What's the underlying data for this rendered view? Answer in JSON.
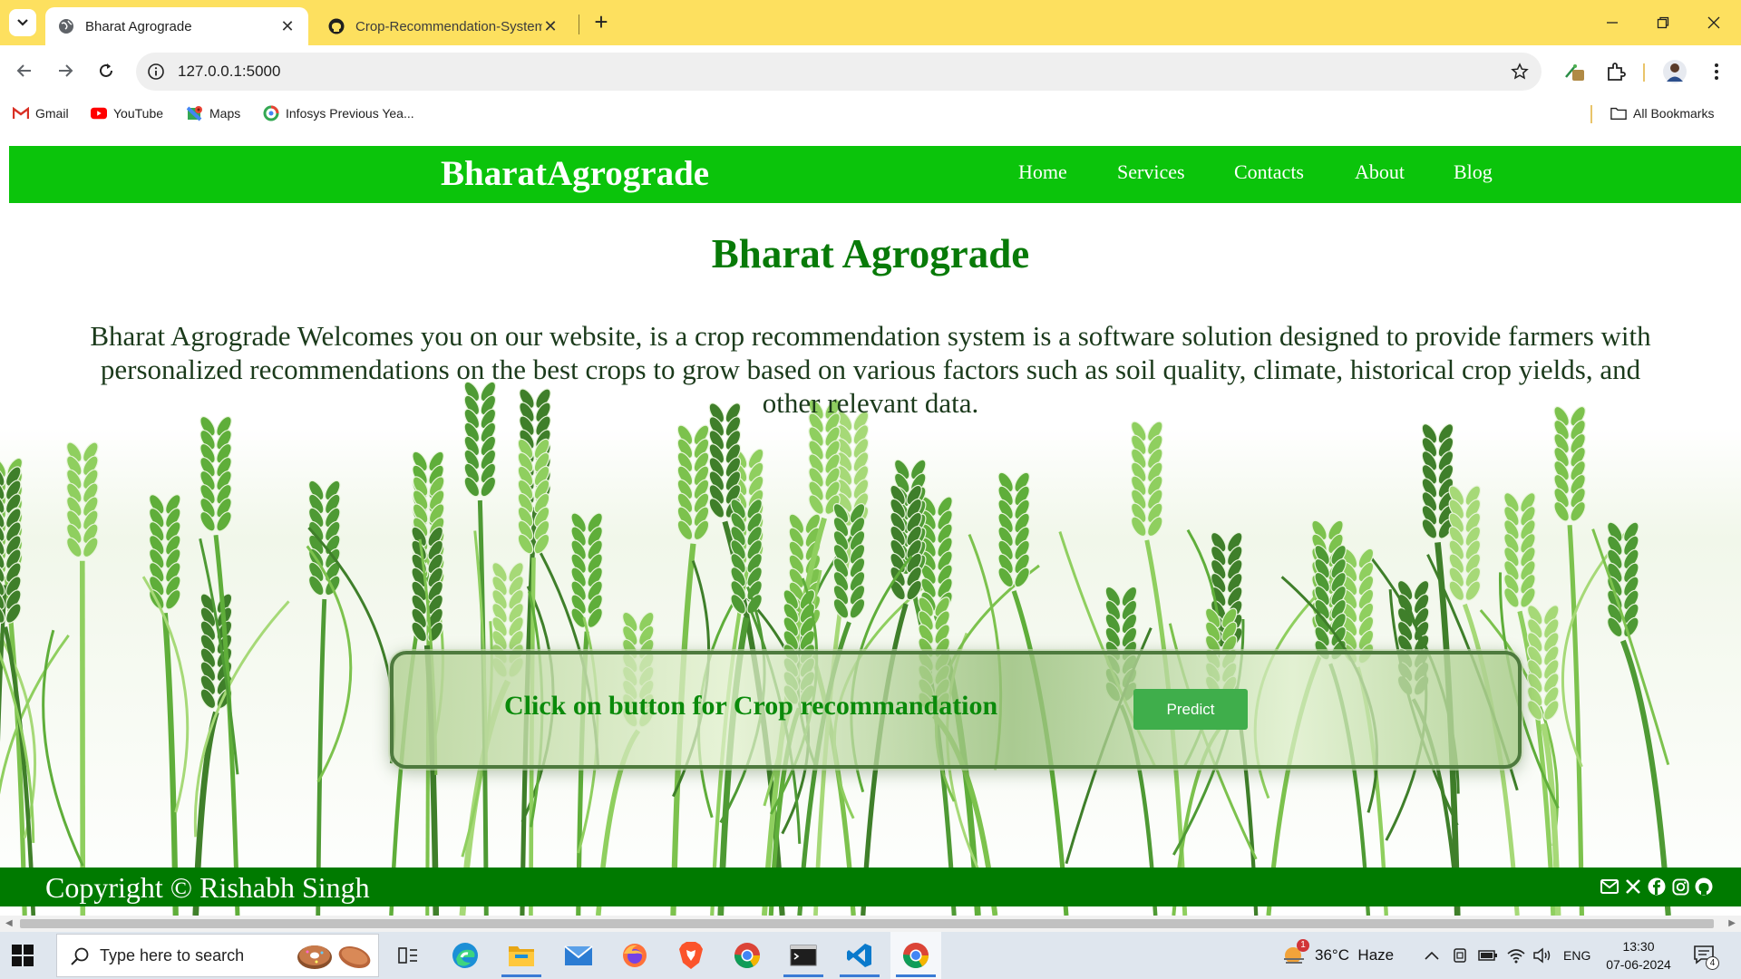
{
  "browser": {
    "tabs": [
      {
        "title": "Bharat Agrograde",
        "active": true
      },
      {
        "title": "Crop-Recommendation-System",
        "active": false
      }
    ],
    "url": "127.0.0.1:5000",
    "bookmarks": [
      {
        "label": "Gmail",
        "icon": "gmail-icon"
      },
      {
        "label": "YouTube",
        "icon": "youtube-icon"
      },
      {
        "label": "Maps",
        "icon": "maps-icon"
      },
      {
        "label": "Infosys Previous Yea...",
        "icon": "infosys-icon"
      }
    ],
    "all_bookmarks_label": "All Bookmarks"
  },
  "site": {
    "brand": "BharatAgrograde",
    "nav": [
      "Home",
      "Services",
      "Contacts",
      "About",
      "Blog"
    ],
    "heading": "Bharat Agrograde",
    "intro": "Bharat Agrograde Welcomes you on our website, is a crop recommendation system is a software solution designed to provide farmers with personalized recommendations on the best crops to grow based on various factors such as soil quality, climate, historical crop yields, and other relevant data.",
    "cta": {
      "text": "Click on button for Crop recommandation",
      "button": "Predict"
    },
    "footer": {
      "copyright": "Copyright © Rishabh Singh",
      "socials": [
        "mail-icon",
        "x-icon",
        "facebook-icon",
        "instagram-icon",
        "github-icon"
      ]
    },
    "colors": {
      "nav_green": "#0bc40b",
      "heading_green": "#087a08",
      "footer_green": "#007a00",
      "button_green": "#3fae4b"
    }
  },
  "taskbar": {
    "search_placeholder": "Type here to search",
    "apps": [
      "task-view-icon",
      "edge-icon",
      "file-explorer-icon",
      "mail-icon",
      "firefox-icon",
      "brave-icon",
      "chrome-icon",
      "terminal-icon",
      "vscode-icon",
      "chrome-icon"
    ],
    "weather_badge": "1",
    "weather": "36°C  Haze",
    "language": "ENG",
    "time": "13:30",
    "date": "07-06-2024",
    "notification_count": "4"
  }
}
